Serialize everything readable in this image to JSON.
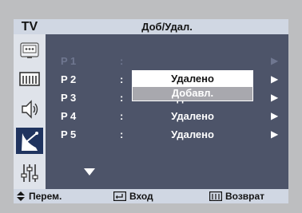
{
  "header": {
    "tv_label": "TV",
    "title": "Доб/Удал."
  },
  "sidebar": {
    "icons": [
      "picture-icon",
      "screen-icon",
      "sound-icon",
      "channel-icon",
      "setup-icon"
    ],
    "active": "channel-icon"
  },
  "rows": [
    {
      "program": "P 1",
      "colon": ":",
      "status": ""
    },
    {
      "program": "P 2",
      "colon": ":",
      "status": ""
    },
    {
      "program": "P 3",
      "colon": ":",
      "status": "Удалено"
    },
    {
      "program": "P 4",
      "colon": ":",
      "status": "Удалено"
    },
    {
      "program": "P 5",
      "colon": ":",
      "status": "Удалено"
    }
  ],
  "popup": {
    "option_1": "Удалено",
    "option_2": "Добавл."
  },
  "footer": {
    "move_label": "Перем.",
    "enter_label": "Вход",
    "return_label": "Возврат"
  },
  "colors": {
    "panel": "#4d5469",
    "header": "#d0d7e3",
    "sidebar": "#dfe3ea",
    "active_icon": "#20345f",
    "highlight": "#a8a8ae"
  }
}
